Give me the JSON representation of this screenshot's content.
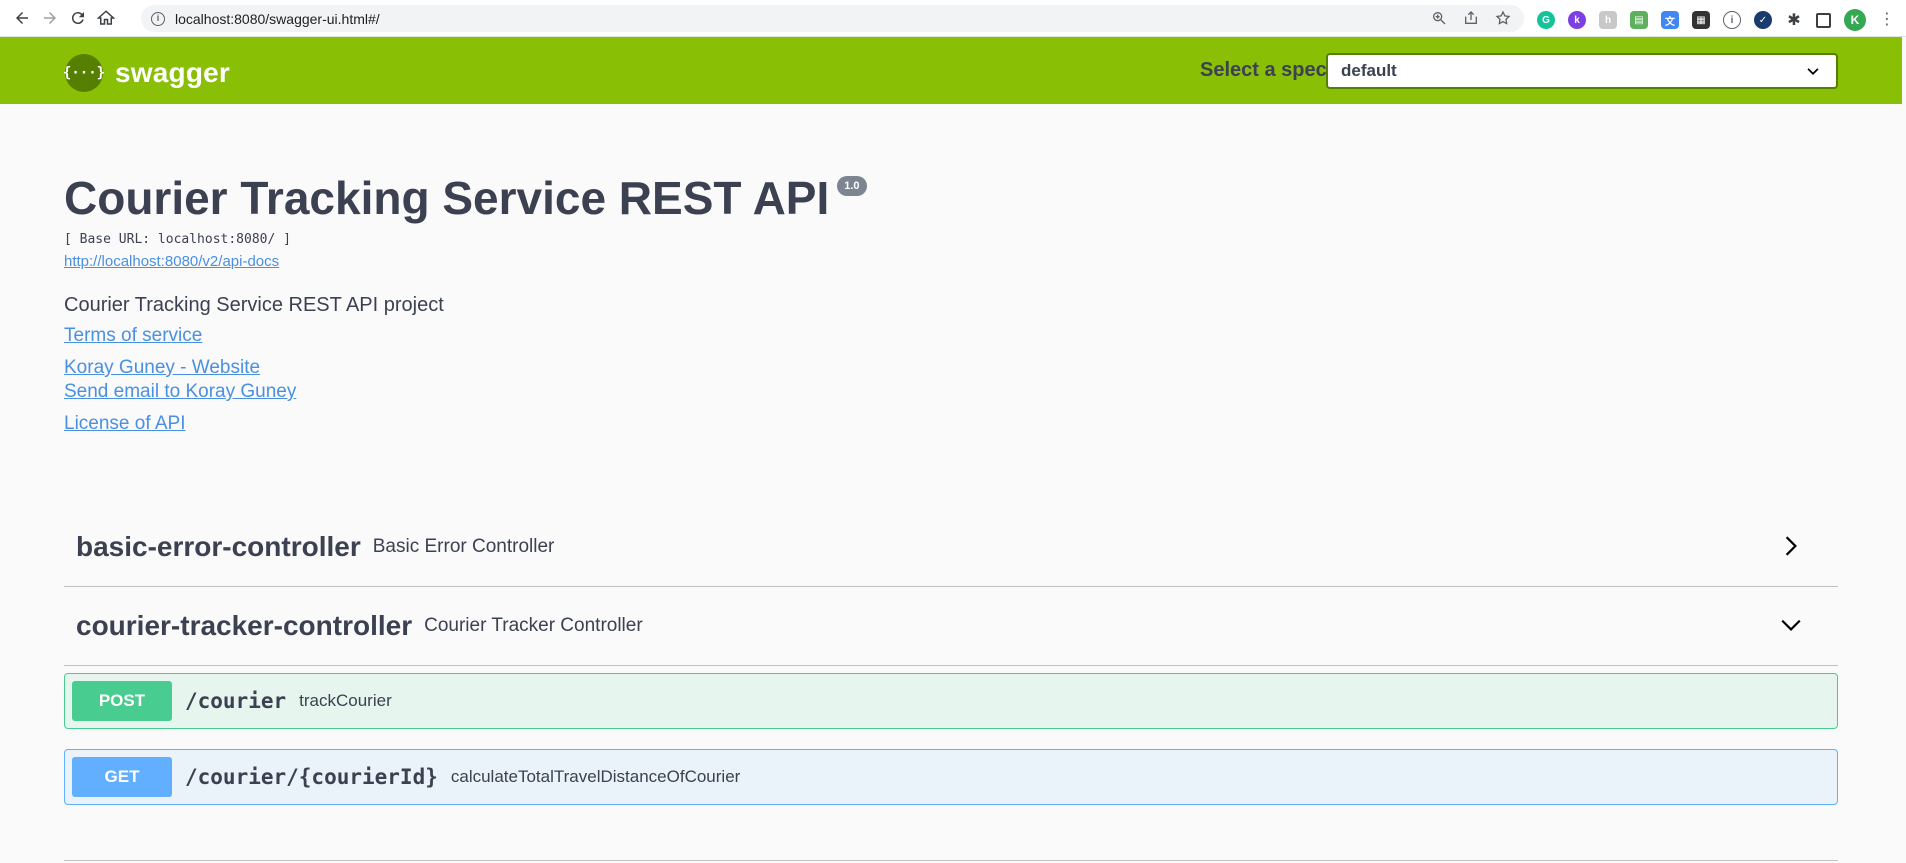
{
  "browser": {
    "url": "localhost:8080/swagger-ui.html#/",
    "avatar_letter": "K"
  },
  "topbar": {
    "logo_text": "swagger",
    "logo_glyph": "{···}",
    "spec_label": "Select a spec",
    "spec_value": "default"
  },
  "info": {
    "title": "Courier Tracking Service REST API",
    "version": "1.0",
    "base_url": "[ Base URL: localhost:8080/ ]",
    "api_docs_link": "http://localhost:8080/v2/api-docs",
    "description": "Courier Tracking Service REST API project",
    "terms": "Terms of service",
    "website": "Koray Guney - Website",
    "email": "Send email to Koray Guney",
    "license": "License of API"
  },
  "tags": [
    {
      "name": "basic-error-controller",
      "description": "Basic Error Controller",
      "expanded": false
    },
    {
      "name": "courier-tracker-controller",
      "description": "Courier Tracker Controller",
      "expanded": true
    }
  ],
  "operations": [
    {
      "method": "POST",
      "path": "/courier",
      "summary": "trackCourier",
      "color": "#49cc90"
    },
    {
      "method": "GET",
      "path": "/courier/{courierId}",
      "summary": "calculateTotalTravelDistanceOfCourier",
      "color": "#61affe"
    }
  ],
  "colors": {
    "topbar": "#89bf04",
    "link": "#4990e2",
    "text": "#3b4151"
  }
}
